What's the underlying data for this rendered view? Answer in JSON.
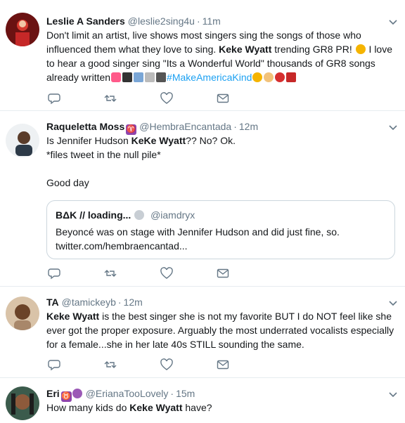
{
  "tweets": [
    {
      "name": "Leslie A Sanders",
      "handle": "@leslie2sing4u",
      "separator": "·",
      "time": "11m",
      "text_a": "Don't limit an artist, live shows most singers sing the songs of those who influenced them what they love to sing. ",
      "bold": "Keke Wyatt",
      "text_b": " trending GR8 PR! ",
      "text_c": " I love to hear a good singer sing \"Its a Wonderful World\"  thousands of GR8 songs already written",
      "text_d": " ",
      "hashtag": "#MakeAmericaKind"
    },
    {
      "name": "Raqueletta Moss",
      "badge": "♈",
      "handle": "@HembraEncantada",
      "separator": "·",
      "time": "12m",
      "line1_a": "Is Jennifer Hudson ",
      "line1_bold": "KeKe Wyatt",
      "line1_b": "?? No? Ok.",
      "line2": "*files tweet in the null pile*",
      "line3": "Good day",
      "quote": {
        "name": "BΔK // loading...",
        "handle": "@iamdryx",
        "text": "Beyoncé was on stage with Jennifer Hudson and did just fine, so.",
        "link": "twitter.com/hembraencantad..."
      }
    },
    {
      "name": "TA",
      "handle": "@tamickeyb",
      "separator": "·",
      "time": "12m",
      "bold": "Keke Wyatt",
      "text": " is the best singer she is not my favorite BUT I do NOT feel like she ever got the proper exposure. Arguably the most underrated vocalists especially for a female...she in her late 40s STILL sounding the same."
    },
    {
      "name": "Eri",
      "badge": "♉",
      "handle": "@ErianaTooLovely",
      "separator": "·",
      "time": "15m",
      "text_a": "How many kids do ",
      "bold": "Keke Wyatt",
      "text_b": " have?"
    }
  ],
  "icons": {
    "reply": "reply-icon",
    "retweet": "retweet-icon",
    "like": "heart-icon",
    "dm": "envelope-icon",
    "more": "chevron-down-icon"
  },
  "colors": {
    "text": "#14171a",
    "muted": "#657786",
    "link": "#1da1f2",
    "border": "#e6ecf0"
  }
}
